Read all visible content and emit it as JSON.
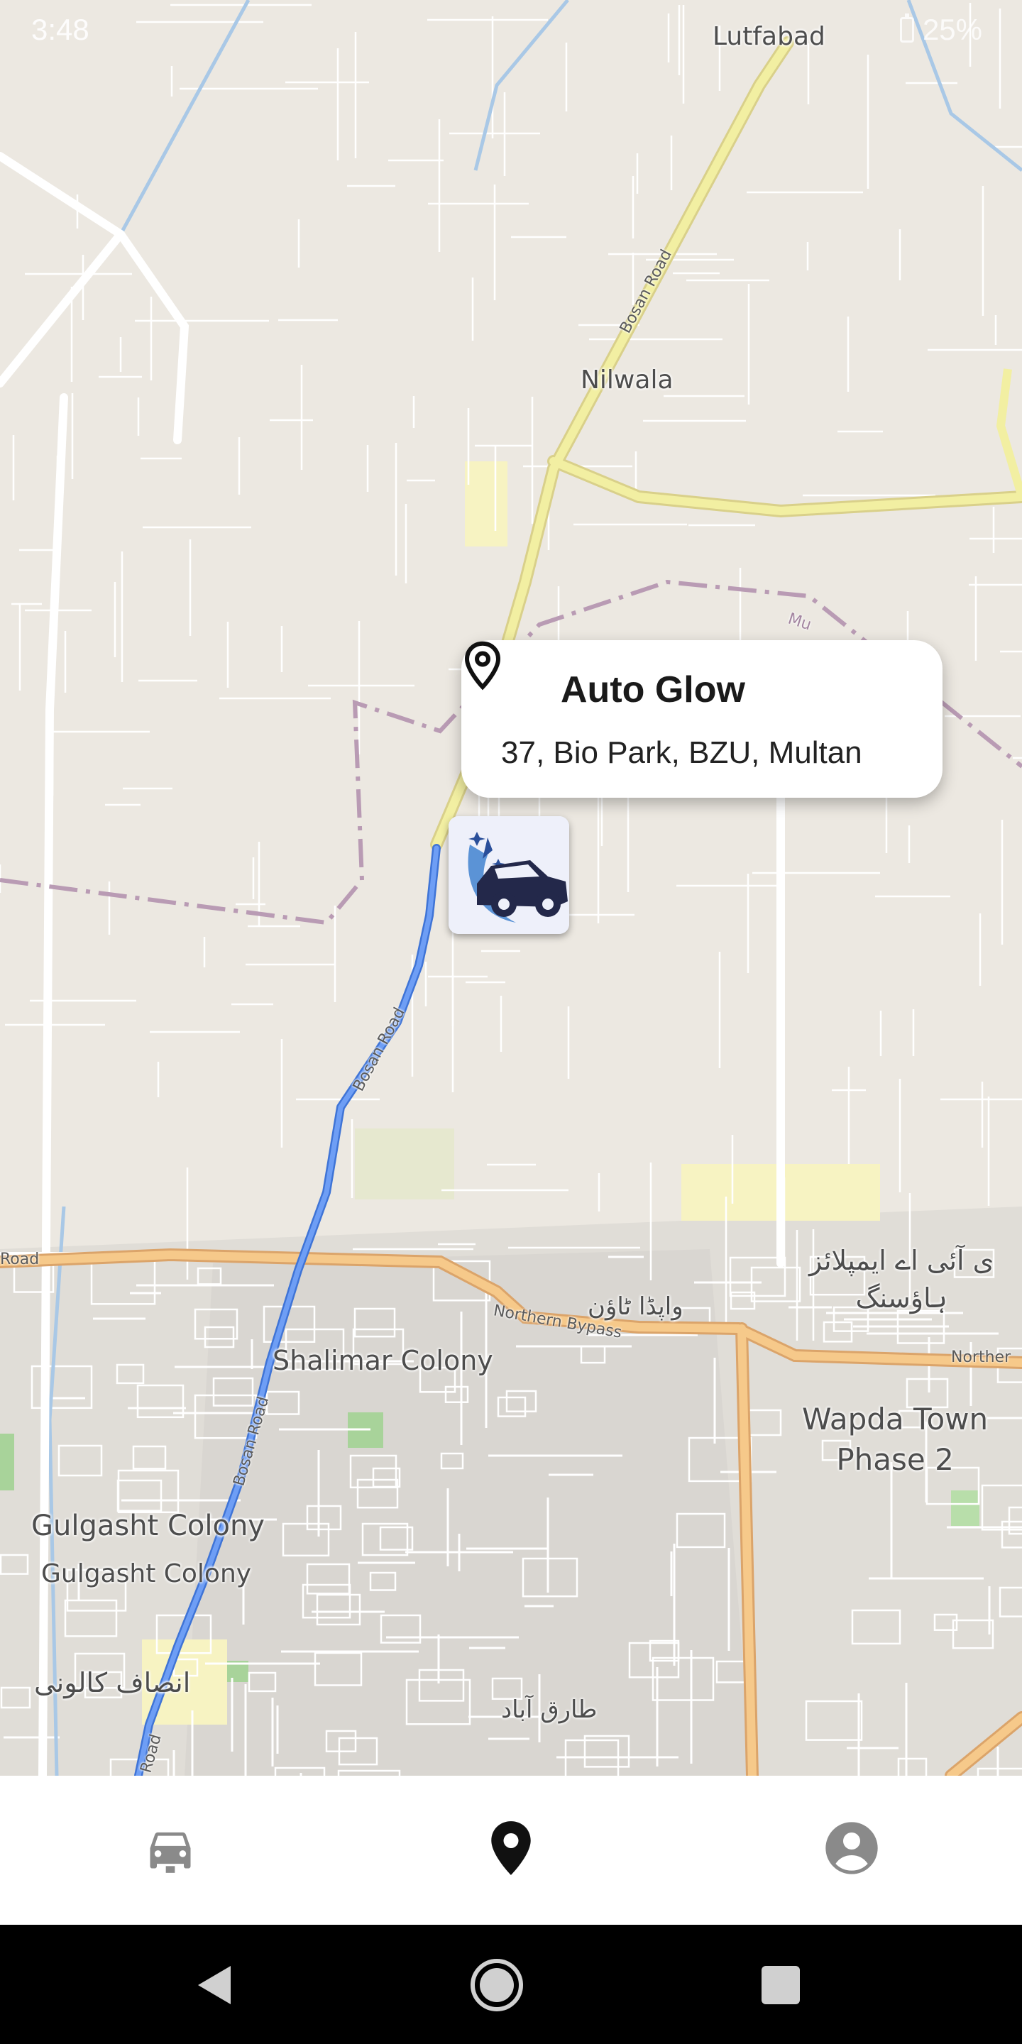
{
  "status_bar": {
    "time": "3:48",
    "battery": "25%"
  },
  "map": {
    "place_labels": [
      {
        "id": "lutfabad",
        "text": "Lutfabad"
      },
      {
        "id": "nilwala",
        "text": "Nilwala"
      },
      {
        "id": "shalimar",
        "text": "Shalimar Colony"
      },
      {
        "id": "gulgasht1",
        "text": "Gulgasht Colony"
      },
      {
        "id": "gulgasht2",
        "text": "Gulgasht Colony"
      },
      {
        "id": "wapda",
        "text": "Wapda Town\nPhase 2"
      },
      {
        "id": "employees",
        "text": "ی آئی اے ایمپلائز\nہاؤسنگ"
      },
      {
        "id": "wapda_ur",
        "text": "واپڈا ٹاؤن"
      },
      {
        "id": "insaf",
        "text": "انصاف کالونی"
      },
      {
        "id": "tariq",
        "text": "طارق آباد"
      }
    ],
    "road_labels": [
      {
        "id": "bosan1",
        "text": "Bosan Road"
      },
      {
        "id": "bosan2",
        "text": "Bosan Road"
      },
      {
        "id": "bosan3",
        "text": "Bosan Road"
      },
      {
        "id": "bosan4",
        "text": "Road"
      },
      {
        "id": "northern",
        "text": "Northern Bypass"
      },
      {
        "id": "northern2",
        "text": "Norther"
      },
      {
        "id": "road_left",
        "text": "Road"
      },
      {
        "id": "mu",
        "text": "Mu"
      }
    ]
  },
  "info_card": {
    "title": "Auto Glow",
    "address": "37, Bio Park, BZU, Multan"
  },
  "marker": {
    "icon": "car-wash-logo"
  },
  "bottom_nav": {
    "items": [
      {
        "icon": "car-icon",
        "active": false
      },
      {
        "icon": "location-pin-icon",
        "active": true
      },
      {
        "icon": "account-circle-icon",
        "active": false
      }
    ]
  },
  "colors": {
    "route": "#5b8ef0",
    "major_road": "#f2c880",
    "trunk_road": "#f0ee9c",
    "boundary": "#b89ab0",
    "water": "#9fc6e8"
  }
}
